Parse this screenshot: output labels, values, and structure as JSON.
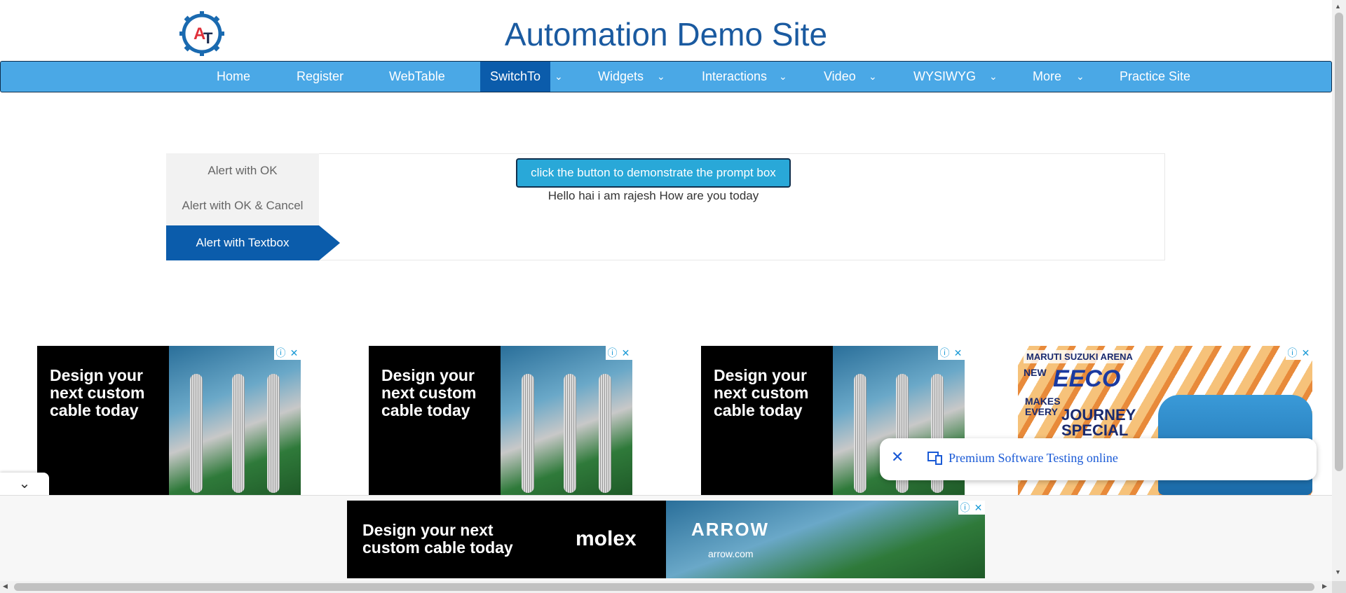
{
  "header": {
    "title": "Automation Demo Site",
    "logo_letters": "AT"
  },
  "nav": {
    "items": [
      {
        "label": "Home"
      },
      {
        "label": "Register"
      },
      {
        "label": "WebTable"
      },
      {
        "label": "SwitchTo",
        "active": true
      },
      {
        "label": "Widgets"
      },
      {
        "label": "Interactions"
      },
      {
        "label": "Video"
      },
      {
        "label": "WYSIWYG"
      },
      {
        "label": "More"
      },
      {
        "label": "Practice Site"
      }
    ],
    "caret": "⌄"
  },
  "tabs": {
    "items": [
      {
        "label": "Alert with OK"
      },
      {
        "label": "Alert with OK & Cancel"
      },
      {
        "label": "Alert with Textbox",
        "active": true
      }
    ]
  },
  "main": {
    "button_label": "click the button to demonstrate the prompt box",
    "result_text": "Hello hai i am rajesh How are you today"
  },
  "ads": {
    "cable_text": "Design your next custom cable today",
    "close_info": "ⓘ",
    "close_x": "✕",
    "maruti": {
      "brand": "MARUTI SUZUKI ARENA",
      "new": "NEW",
      "eeco": "EECO",
      "makes": "MAKES EVERY",
      "journey": "JOURNEY SPECIAL"
    },
    "bottom": {
      "text": "Design your next custom cable today",
      "molex": "molex",
      "arrow": "ARROW",
      "arrow_url": "arrow.com"
    }
  },
  "toast": {
    "text": "Premium Software Testing online"
  },
  "colors": {
    "nav_bg": "#4aa8e6",
    "active": "#0b5cab",
    "title": "#1a5aa0",
    "button": "#29a8d8"
  }
}
